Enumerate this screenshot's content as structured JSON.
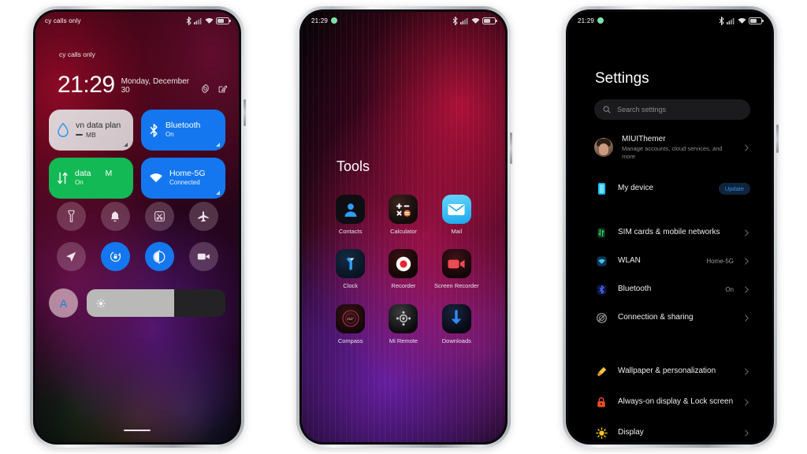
{
  "background_color": "#ffffff",
  "phones": {
    "left": {
      "name": "control-center",
      "statusbar": {
        "carrier": "cy calls only"
      },
      "lock": {
        "time": "21:29",
        "date": "Monday, December 30",
        "actions": [
          "settings-gear-icon",
          "edit-note-icon"
        ]
      },
      "tiles": [
        {
          "id": "data-plan",
          "title": "vn data plan",
          "value": "MB",
          "sub": "",
          "icon": "water-drop-icon",
          "state": "neutral",
          "color": "#ded3d6"
        },
        {
          "id": "bluetooth",
          "title": "Bluetooth",
          "sub": "On",
          "icon": "bluetooth-icon",
          "state": "on",
          "color": "#1477f0"
        },
        {
          "id": "mobile-data",
          "title": "data",
          "title_extra": "M",
          "sub": "On",
          "icon": "data-arrows-icon",
          "state": "on",
          "color": "#12b954"
        },
        {
          "id": "wlan",
          "title": "Home-5G",
          "sub": "Connected",
          "icon": "wifi-icon",
          "state": "on",
          "color": "#1477f0"
        }
      ],
      "toggles": [
        {
          "id": "flashlight",
          "icon": "flashlight-icon",
          "state": "off"
        },
        {
          "id": "ringer",
          "icon": "bell-icon",
          "state": "off"
        },
        {
          "id": "screenshot",
          "icon": "scissors-crop-icon",
          "state": "off"
        },
        {
          "id": "airplane",
          "icon": "airplane-icon",
          "state": "off"
        },
        {
          "id": "location",
          "icon": "location-arrow-icon",
          "state": "off"
        },
        {
          "id": "auto-rotate",
          "icon": "rotate-lock-icon",
          "state": "on"
        },
        {
          "id": "dark-mode",
          "icon": "contrast-circle-icon",
          "state": "on"
        },
        {
          "id": "screen-recorder",
          "icon": "video-camera-icon",
          "state": "off"
        }
      ],
      "brightness": {
        "auto_label": "A",
        "auto_icon": "auto-brightness-icon",
        "slider_icon": "sun-icon",
        "slider_percent": 63
      }
    },
    "middle": {
      "name": "tools-folder",
      "statusbar": {
        "time": "21:29"
      },
      "folder_title": "Tools",
      "apps": [
        {
          "label": "Contacts",
          "icon": "contacts-icon"
        },
        {
          "label": "Calculator",
          "icon": "calculator-icon"
        },
        {
          "label": "Mail",
          "icon": "mail-icon"
        },
        {
          "label": "Clock",
          "icon": "clock-icon"
        },
        {
          "label": "Recorder",
          "icon": "recorder-icon"
        },
        {
          "label": "Screen Recorder",
          "icon": "screen-recorder-icon"
        },
        {
          "label": "Compass",
          "icon": "compass-icon",
          "reading": "152°"
        },
        {
          "label": "Mi Remote",
          "icon": "mi-remote-icon"
        },
        {
          "label": "Downloads",
          "icon": "downloads-icon"
        }
      ]
    },
    "right": {
      "name": "settings",
      "statusbar": {
        "time": "21:29"
      },
      "title": "Settings",
      "search": {
        "placeholder": "Search settings",
        "icon": "search-icon"
      },
      "account": {
        "name": "MIUIThemer",
        "subtitle": "Manage accounts, cloud services, and more",
        "avatar": "user-photo-avatar"
      },
      "device": {
        "label": "My device",
        "badge": "Update",
        "icon": "phone-device-icon",
        "badge_color": "#2f90ef"
      },
      "groups": [
        {
          "rows": [
            {
              "label": "SIM cards & mobile networks",
              "value": "",
              "icon": "sim-card-icon",
              "color": "#2bbf55"
            },
            {
              "label": "WLAN",
              "value": "Home-5G",
              "icon": "wifi-icon",
              "color": "#28a9e8"
            },
            {
              "label": "Bluetooth",
              "value": "On",
              "icon": "bluetooth-icon",
              "color": "#2b5df0"
            },
            {
              "label": "Connection & sharing",
              "value": "",
              "icon": "connection-sharing-icon",
              "color": "#8b8b90"
            }
          ]
        },
        {
          "rows": [
            {
              "label": "Wallpaper & personalization",
              "value": "",
              "icon": "wallpaper-brush-icon",
              "color": "#f0b429"
            },
            {
              "label": "Always-on display & Lock screen",
              "value": "",
              "icon": "lock-icon",
              "color": "#e8502a",
              "tall": true
            },
            {
              "label": "Display",
              "value": "",
              "icon": "brightness-sun-icon",
              "color": "#f5c518"
            }
          ]
        }
      ]
    }
  }
}
